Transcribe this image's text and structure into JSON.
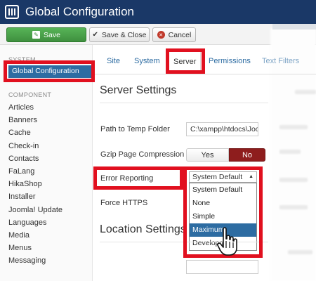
{
  "app": {
    "title": "Global Configuration"
  },
  "toolbar": {
    "save_label": "Save",
    "save_close_label": "Save & Close",
    "cancel_label": "Cancel"
  },
  "sidebar": {
    "system_heading": "SYSTEM",
    "active_item": "Global Configuration",
    "component_heading": "COMPONENT",
    "items": [
      "Articles",
      "Banners",
      "Cache",
      "Check-in",
      "Contacts",
      "FaLang",
      "HikaShop",
      "Installer",
      "Joomla! Update",
      "Languages",
      "Media",
      "Menus",
      "Messaging"
    ]
  },
  "tabs": [
    {
      "label": "Site",
      "active": false
    },
    {
      "label": "System",
      "active": false
    },
    {
      "label": "Server",
      "active": true
    },
    {
      "label": "Permissions",
      "active": false
    },
    {
      "label": "Text Filters",
      "active": false
    }
  ],
  "server_settings": {
    "heading": "Server Settings",
    "temp_folder_label": "Path to Temp Folder",
    "temp_folder_value": "C:\\xampp\\htdocs\\Joo",
    "gzip_label": "Gzip Page Compression",
    "gzip_yes": "Yes",
    "gzip_no": "No",
    "gzip_selected": "No",
    "error_reporting_label": "Error Reporting",
    "error_reporting_value": "System Default",
    "error_reporting_options": [
      "System Default",
      "None",
      "Simple",
      "Maximum",
      "Development"
    ],
    "error_reporting_highlighted": "Maximum",
    "force_https_label": "Force HTTPS"
  },
  "location_settings": {
    "heading": "Location Settings"
  },
  "colors": {
    "header": "#1a3867",
    "accent": "#2d6ca2",
    "save_green": "#46a046",
    "no_red": "#8e1d1d",
    "highlight_red": "#e1101f"
  },
  "icons": {
    "logo": "joomla-config-icon",
    "save": "edit-check-icon",
    "save_close": "check-icon",
    "cancel": "cancel-circle-icon",
    "dropdown": "caret-up-icon",
    "cursor": "hand-pointer-icon"
  }
}
